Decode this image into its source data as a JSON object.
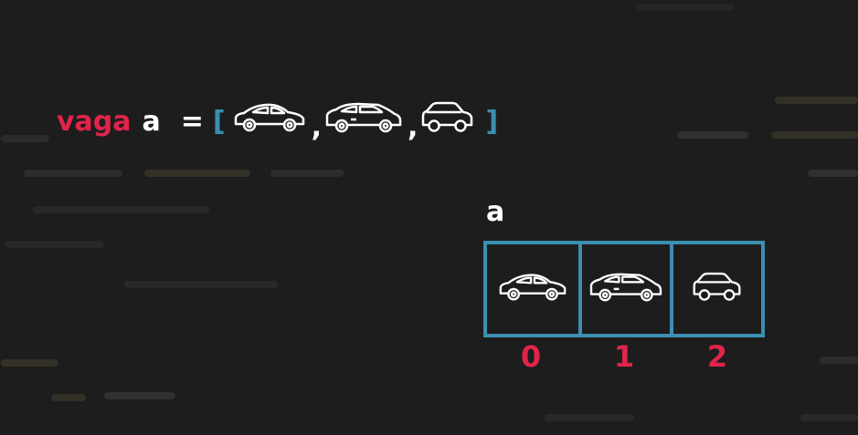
{
  "code": {
    "keyword": "vaga",
    "variable": "a",
    "equals": "=",
    "open_bracket": "[",
    "separator": ",",
    "close_bracket": "]",
    "cars": [
      "sedan-icon",
      "hatchback-icon",
      "compact-car-icon"
    ]
  },
  "array": {
    "label": "a",
    "cells": [
      {
        "icon": "sedan-icon",
        "index": "0"
      },
      {
        "icon": "hatchback-icon",
        "index": "1"
      },
      {
        "icon": "compact-car-icon",
        "index": "2"
      }
    ]
  },
  "colors": {
    "background": "#1d1d1d",
    "keyword": "#e0244a",
    "bracket_and_border": "#3b8fb0",
    "text": "#ffffff"
  }
}
